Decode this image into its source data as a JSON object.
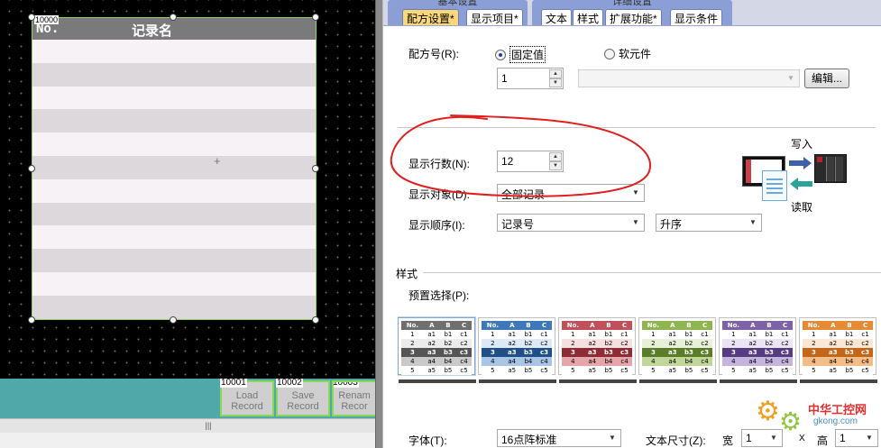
{
  "canvas": {
    "table_id": "10000",
    "header_no": "No.",
    "header_name": "记录名",
    "row_count": 12,
    "buttons": [
      {
        "id": "10001",
        "line1": "Load",
        "line2": "Record"
      },
      {
        "id": "10002",
        "line1": "Save",
        "line2": "Record"
      },
      {
        "id": "10003",
        "line1": "Renam",
        "line2": "Recor"
      }
    ],
    "scroll_thumb": "|||"
  },
  "tabs": {
    "basic_group": "基本设置",
    "detail_group": "详细设置",
    "items": [
      {
        "label": "配方设置*",
        "active": true
      },
      {
        "label": "显示项目*",
        "active": false
      },
      {
        "label": "文本",
        "active": false
      },
      {
        "label": "样式",
        "active": false
      },
      {
        "label": "扩展功能*",
        "active": false
      },
      {
        "label": "显示条件",
        "active": false
      }
    ]
  },
  "recipe": {
    "number_label": "配方号(R):",
    "radio_fixed": "固定值",
    "radio_device": "软元件",
    "fixed_value": "1",
    "edit_button": "编辑...",
    "rows_label": "显示行数(N):",
    "rows_value": "12",
    "target_label": "显示对象(D):",
    "target_value": "全部记录",
    "order_label": "显示顺序(I):",
    "order_value": "记录号",
    "order_dir": "升序"
  },
  "write_read": {
    "write": "写入",
    "read": "读取"
  },
  "style": {
    "section_title": "样式",
    "preset_label": "预置选择(P):",
    "swatch_header": [
      "No.",
      "A",
      "B",
      "C"
    ],
    "swatch_rows": [
      [
        "1",
        "a1",
        "b1",
        "c1"
      ],
      [
        "2",
        "a2",
        "b2",
        "c2"
      ],
      [
        "3",
        "a3",
        "b3",
        "c3"
      ],
      [
        "4",
        "a4",
        "b4",
        "c4"
      ],
      [
        "5",
        "a5",
        "b5",
        "c5"
      ]
    ],
    "themes": [
      {
        "head": "#6f6f6f",
        "light": "#ececec",
        "mid": "#c9c9c9",
        "dark": "#555555"
      },
      {
        "head": "#3f78b8",
        "light": "#dde9f6",
        "mid": "#a9c5e6",
        "dark": "#1f4f86"
      },
      {
        "head": "#c0505a",
        "light": "#f6dfe1",
        "mid": "#e5a6ab",
        "dark": "#8e2b34"
      },
      {
        "head": "#8fb552",
        "light": "#e7f1d9",
        "mid": "#bfd89a",
        "dark": "#5b7d2a"
      },
      {
        "head": "#7d62a8",
        "light": "#ebe4f4",
        "mid": "#c5b4dd",
        "dark": "#553b80"
      },
      {
        "head": "#e58a35",
        "light": "#fbe8d4",
        "mid": "#f3bd88",
        "dark": "#c4661a"
      }
    ]
  },
  "font": {
    "font_label": "字体(T):",
    "font_value": "16点阵标准",
    "size_label": "文本尺寸(Z):",
    "width_label": "宽",
    "width_value": "1",
    "times": "X",
    "height_label": "高",
    "height_value": "1"
  },
  "watermark": {
    "name": "中华工控网",
    "url": "gkong.com"
  },
  "colors": {
    "annotation": "#e02020",
    "selection_border": "#8cd75a"
  }
}
